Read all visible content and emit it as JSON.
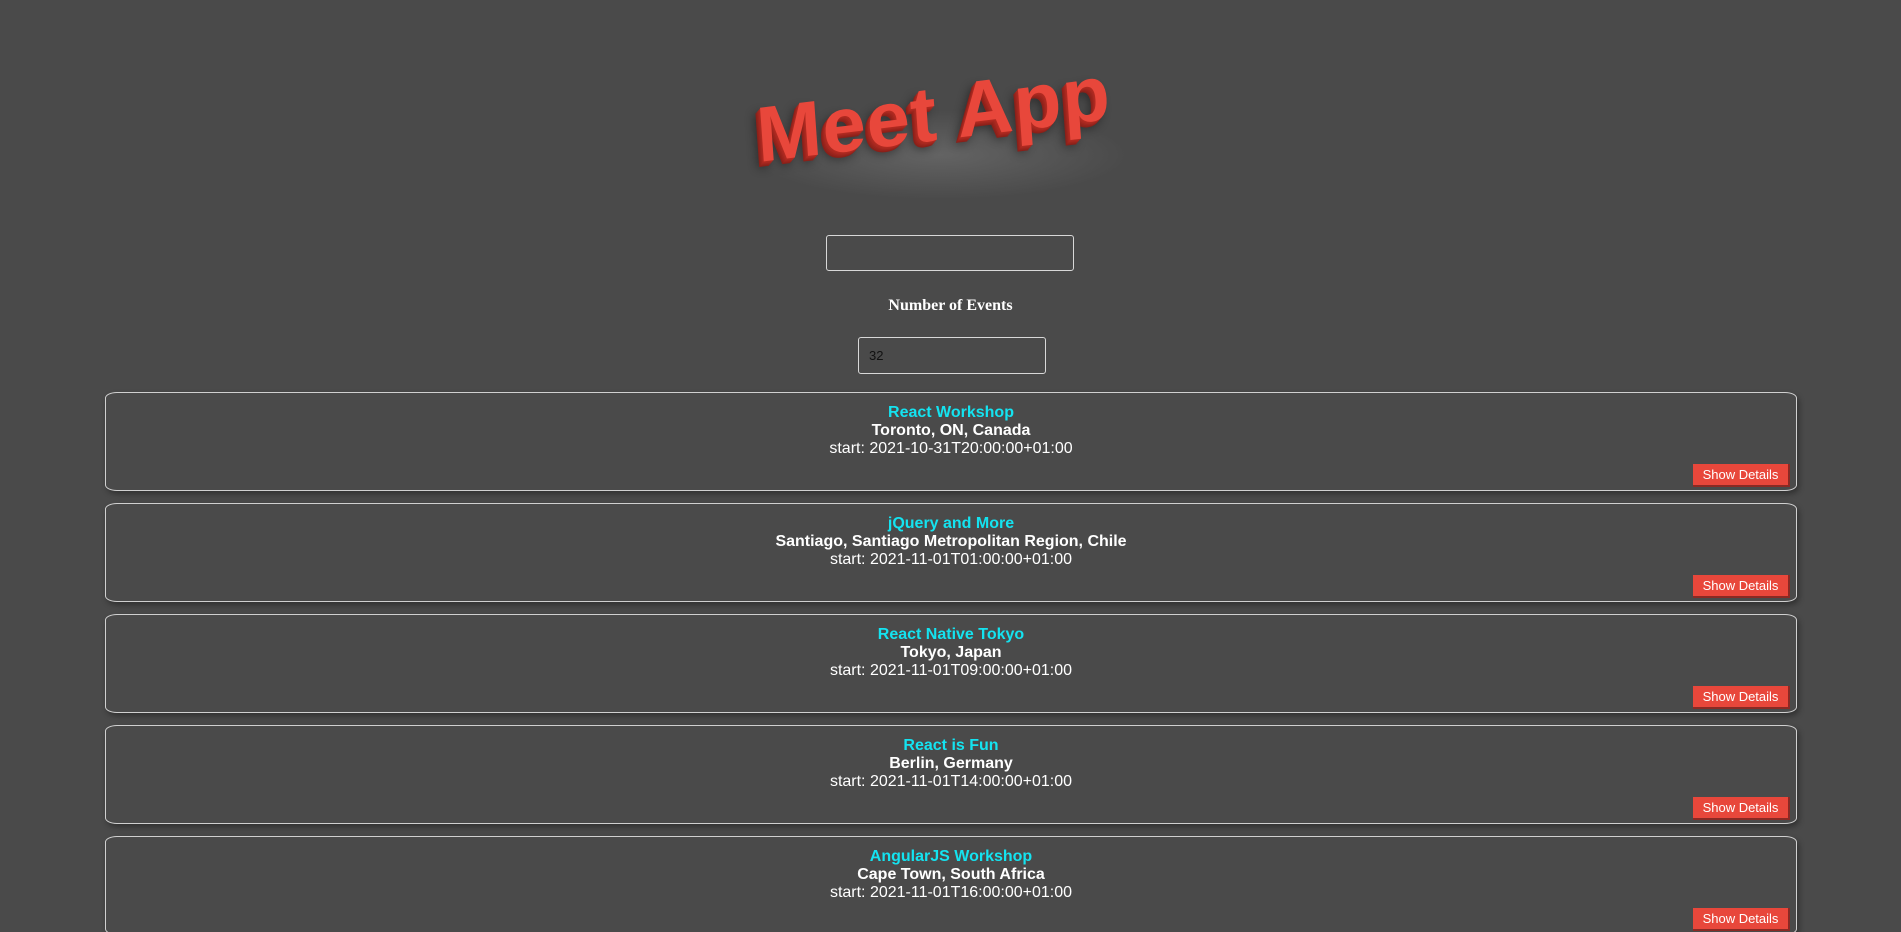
{
  "app": {
    "title": "Meet App"
  },
  "city_search": {
    "value": ""
  },
  "number_of_events": {
    "label": "Number of Events",
    "value": "32"
  },
  "colors": {
    "background": "#4a4a4a",
    "accent": "#e8473b",
    "event_title": "#14e3f0"
  },
  "events": [
    {
      "title": "React Workshop",
      "location": "Toronto, ON, Canada",
      "start": "start: 2021-10-31T20:00:00+01:00",
      "button_label": "Show Details"
    },
    {
      "title": "jQuery and More",
      "location": "Santiago, Santiago Metropolitan Region, Chile",
      "start": "start: 2021-11-01T01:00:00+01:00",
      "button_label": "Show Details"
    },
    {
      "title": "React Native Tokyo",
      "location": "Tokyo, Japan",
      "start": "start: 2021-11-01T09:00:00+01:00",
      "button_label": "Show Details"
    },
    {
      "title": "React is Fun",
      "location": "Berlin, Germany",
      "start": "start: 2021-11-01T14:00:00+01:00",
      "button_label": "Show Details"
    },
    {
      "title": "AngularJS Workshop",
      "location": "Cape Town, South Africa",
      "start": "start: 2021-11-01T16:00:00+01:00",
      "button_label": "Show Details"
    }
  ]
}
